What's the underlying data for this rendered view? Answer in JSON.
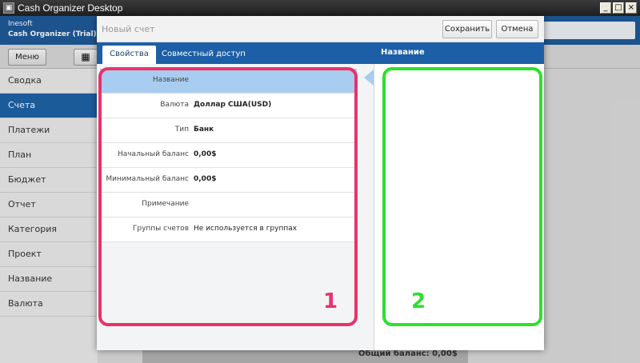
{
  "window": {
    "title": "Cash Organizer Desktop",
    "icon": "app-icon"
  },
  "app": {
    "vendor": "Inesoft",
    "product": "Cash Organizer (Trial)"
  },
  "toolbar": {
    "menu_label": "Меню",
    "calc_icon": "calculator-icon"
  },
  "sidebar": {
    "items": [
      {
        "label": "Сводка"
      },
      {
        "label": "Счета",
        "active": true
      },
      {
        "label": "Платежи"
      },
      {
        "label": "План"
      },
      {
        "label": "Бюджет"
      },
      {
        "label": "Отчет"
      },
      {
        "label": "Категория"
      },
      {
        "label": "Проект"
      },
      {
        "label": "Название"
      },
      {
        "label": "Валюта"
      }
    ]
  },
  "background": {
    "total_label": "Общий баланс: 0,00$"
  },
  "dialog": {
    "title": "Новый счет",
    "save_label": "Сохранить",
    "cancel_label": "Отмена",
    "tabs": [
      {
        "label": "Свойства",
        "active": true
      },
      {
        "label": "Совместный доступ"
      }
    ],
    "right_header": "Название",
    "rows": [
      {
        "label": "Название",
        "value": ""
      },
      {
        "label": "Валюта",
        "value": "Доллар США(USD)"
      },
      {
        "label": "Тип",
        "value": "Банк"
      },
      {
        "label": "Начальный баланс",
        "value": "0,00$"
      },
      {
        "label": "Минимальный баланс",
        "value": "0,00$"
      },
      {
        "label": "Примечание",
        "value": ""
      },
      {
        "label": "Группы счетов",
        "value": "Не используется в группах"
      }
    ]
  },
  "annotations": {
    "box1_number": "1",
    "box2_number": "2",
    "box1_color": "#e8336b",
    "box2_color": "#2ee02e"
  }
}
